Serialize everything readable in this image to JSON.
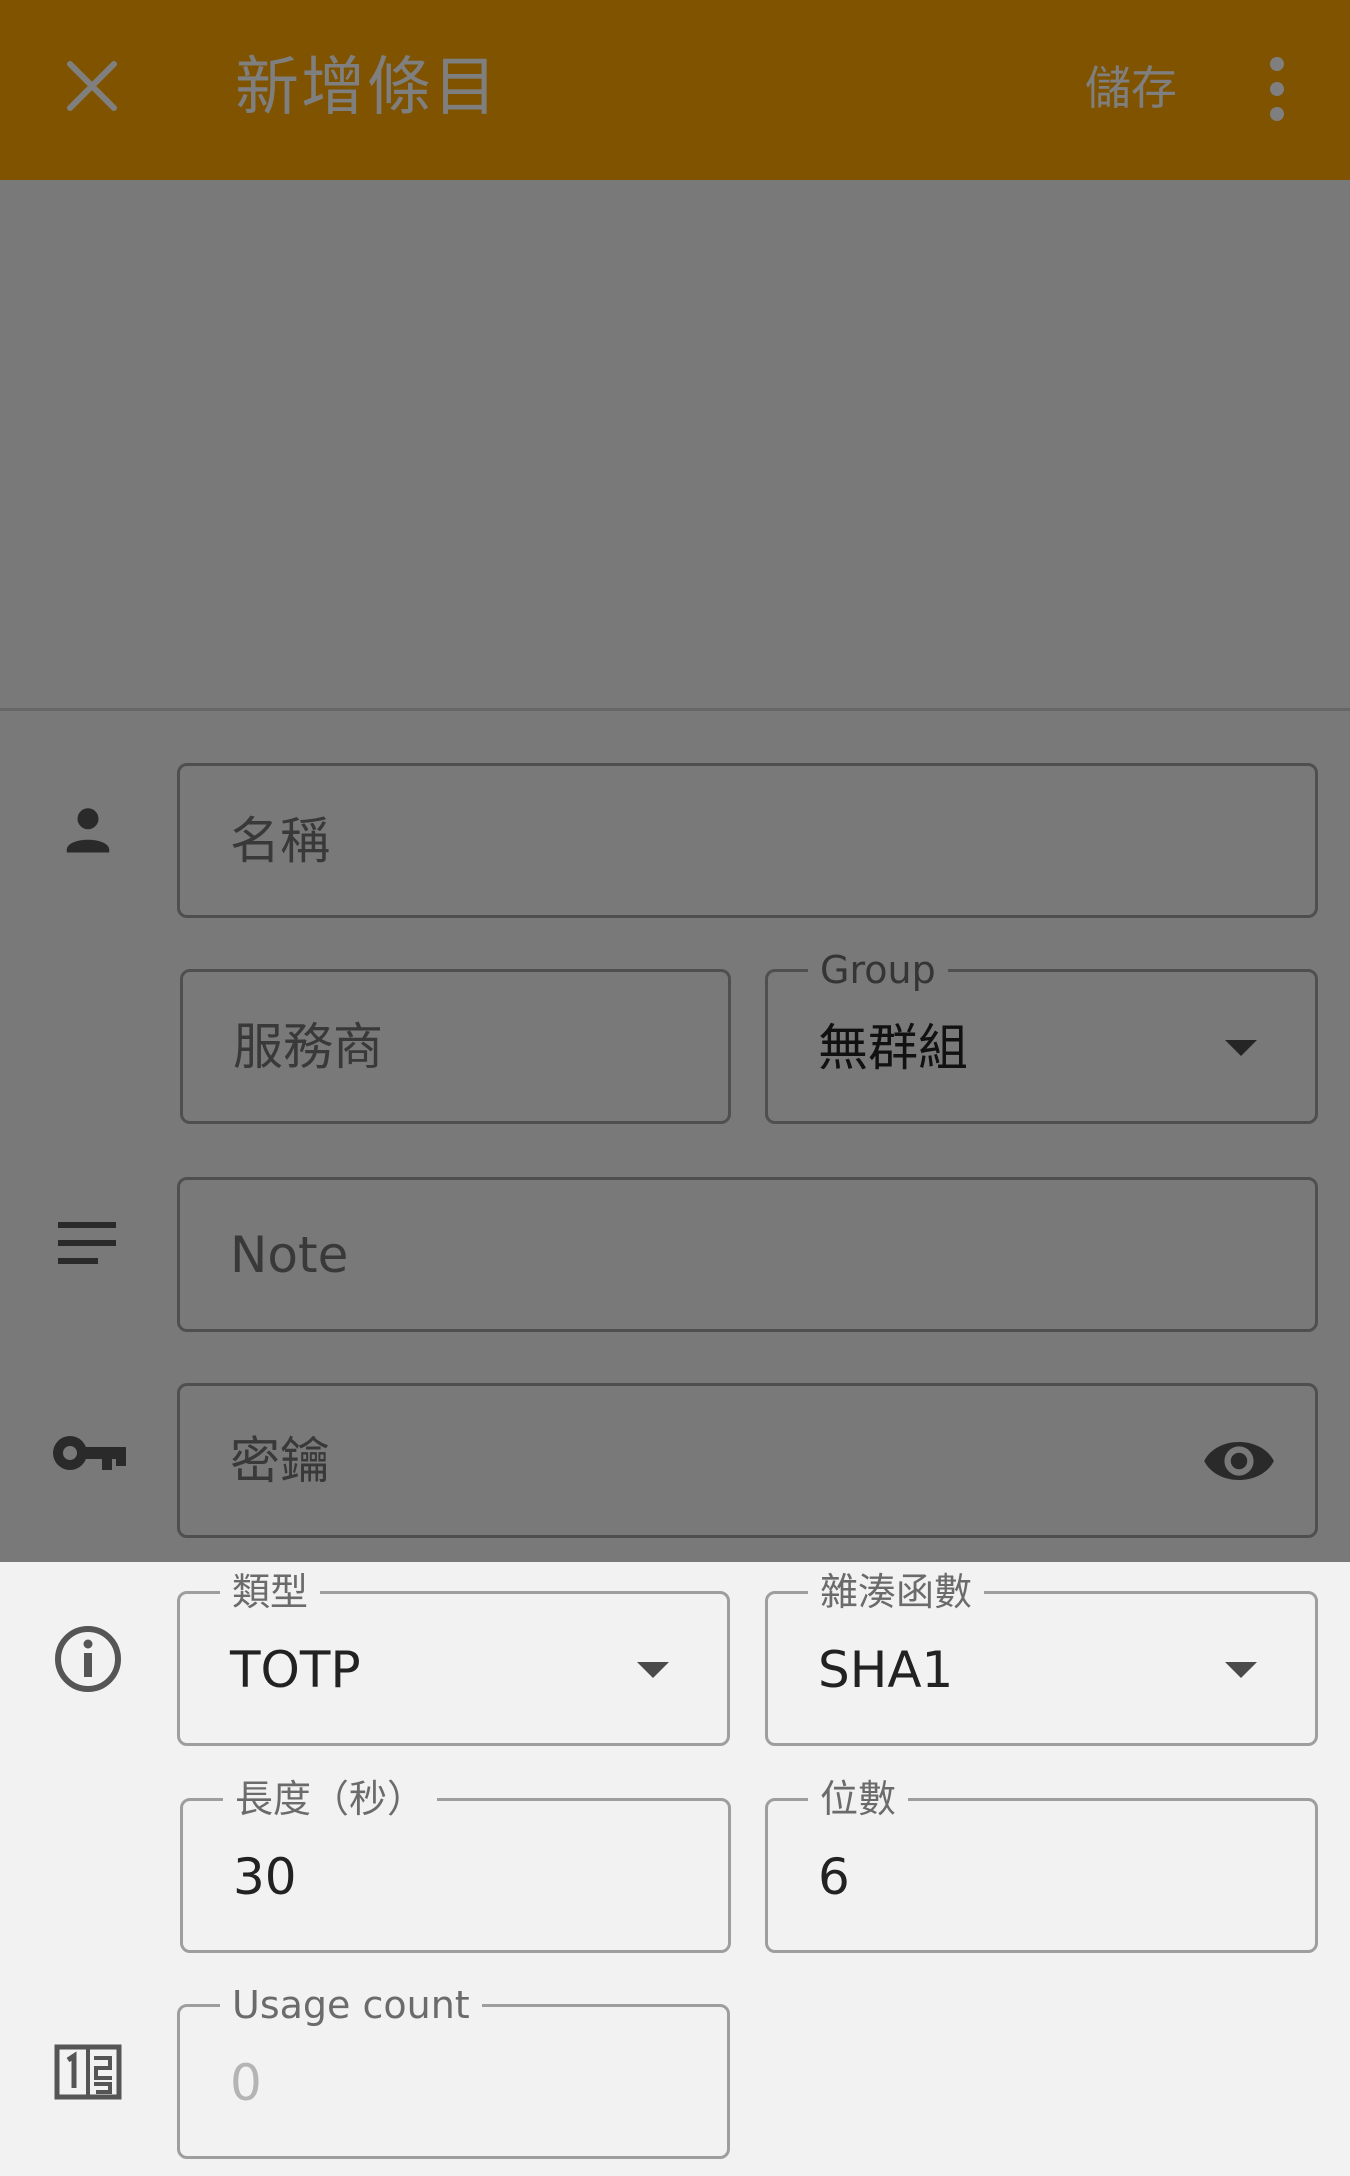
{
  "appbar": {
    "title": "新增條目",
    "save_label": "儲存",
    "close_icon": "close-icon",
    "more_icon": "more-vert-icon",
    "color": "#ffa700"
  },
  "form": {
    "name": {
      "placeholder": "名稱",
      "icon": "person-icon"
    },
    "issuer": {
      "placeholder": "服務商"
    },
    "group": {
      "label": "Group",
      "value": "無群組"
    },
    "note": {
      "placeholder": "Note",
      "icon": "notes-icon"
    },
    "secret": {
      "placeholder": "密鑰",
      "icon": "key-icon",
      "toggle_icon": "eye-icon"
    },
    "type": {
      "label": "類型",
      "value": "TOTP",
      "icon": "info-icon"
    },
    "algorithm": {
      "label": "雜湊函數",
      "value": "SHA1"
    },
    "period": {
      "label": "長度（秒）",
      "value": "30"
    },
    "digits": {
      "label": "位數",
      "value": "6"
    },
    "usage": {
      "label": "Usage count",
      "value": "0",
      "icon": "counter-icon"
    }
  }
}
